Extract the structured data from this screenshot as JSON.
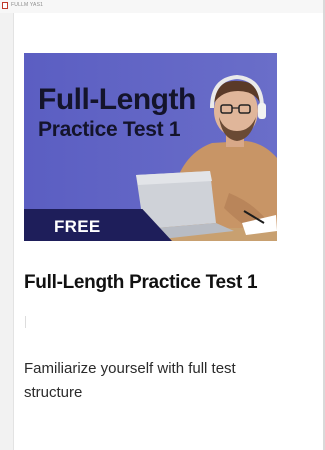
{
  "tab": {
    "title": "FULLM YAS1",
    "favicon": "page-icon"
  },
  "card": {
    "hero": {
      "title_line1": "Full-Length",
      "title_line2": "Practice Test 1",
      "badge": "FREE",
      "image": "student-with-laptop-image",
      "colors": {
        "background": "#5b5ec2",
        "band": "#1e1e5a",
        "title": "#14142b"
      }
    },
    "title": "Full-Length Practice Test 1",
    "description": "Familiarize yourself with full test structure"
  }
}
